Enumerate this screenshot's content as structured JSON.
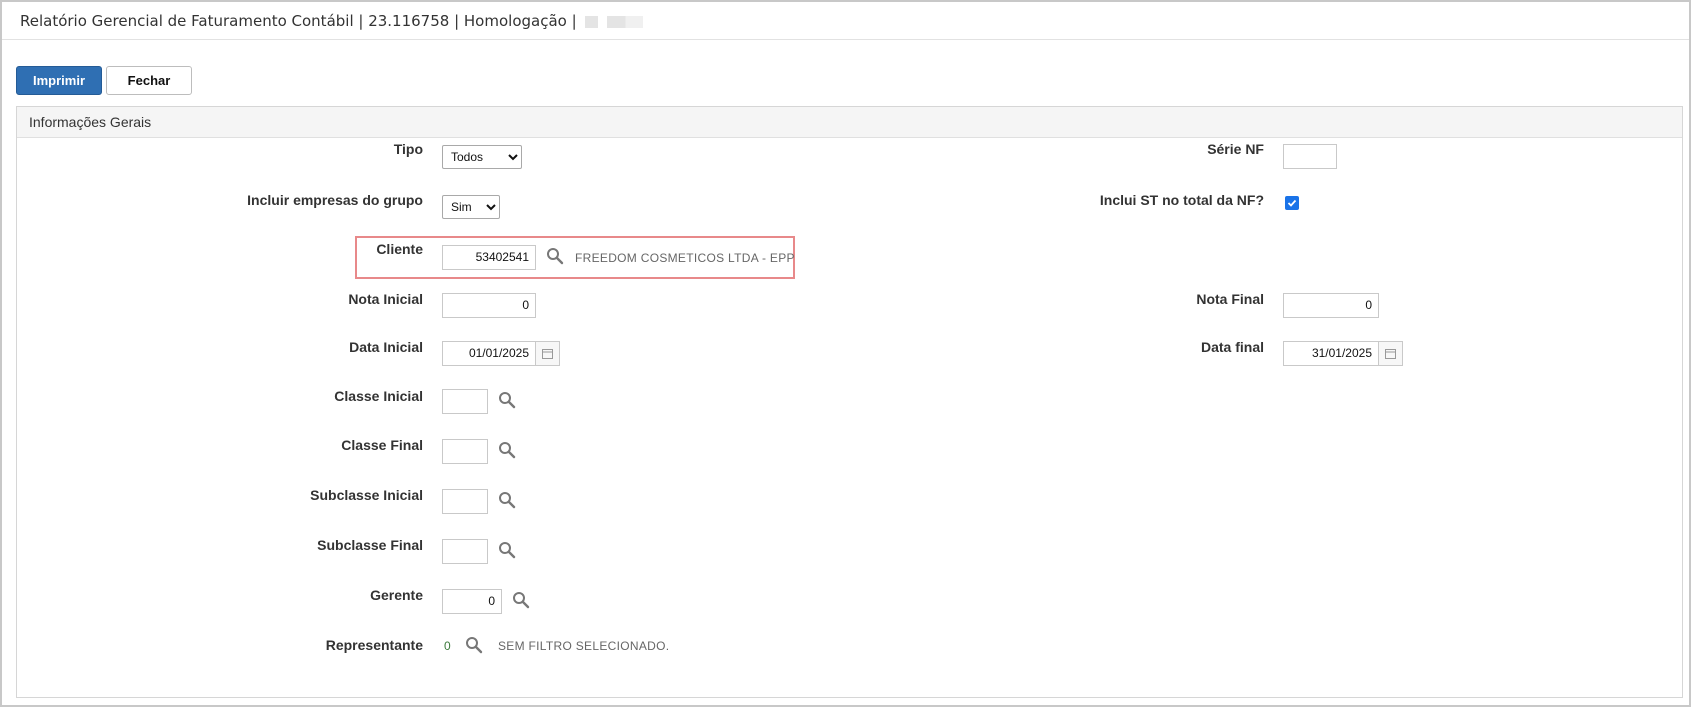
{
  "window": {
    "title": "Relatório Gerencial de Faturamento Contábil | 23.116758 | Homologação |"
  },
  "toolbar": {
    "print_label": "Imprimir",
    "close_label": "Fechar"
  },
  "panel": {
    "title": "Informações Gerais"
  },
  "form": {
    "tipo": {
      "label": "Tipo",
      "value": "Todos",
      "options": [
        "Todos"
      ]
    },
    "incluir_empresas": {
      "label": "Incluir empresas do grupo",
      "value": "Sim",
      "options": [
        "Sim"
      ]
    },
    "cliente": {
      "label": "Cliente",
      "value": "53402541",
      "description": "FREEDOM COSMETICOS LTDA - EPP"
    },
    "nota_inicial": {
      "label": "Nota Inicial",
      "value": "0"
    },
    "data_inicial": {
      "label": "Data Inicial",
      "value": "01/01/2025"
    },
    "classe_inicial": {
      "label": "Classe Inicial",
      "value": ""
    },
    "classe_final": {
      "label": "Classe Final",
      "value": ""
    },
    "subclasse_inicial": {
      "label": "Subclasse Inicial",
      "value": ""
    },
    "subclasse_final": {
      "label": "Subclasse Final",
      "value": ""
    },
    "gerente": {
      "label": "Gerente",
      "value": "0"
    },
    "representante": {
      "label": "Representante",
      "value": "0",
      "description": "SEM FILTRO SELECIONADO."
    },
    "serie_nf": {
      "label": "Série NF",
      "value": ""
    },
    "inclui_st": {
      "label": "Inclui ST no total da NF?",
      "checked": true
    },
    "nota_final": {
      "label": "Nota Final",
      "value": "0"
    },
    "data_final": {
      "label": "Data final",
      "value": "31/01/2025"
    }
  },
  "colors": {
    "primary": "#2f6fb3",
    "highlight": "#e8898a",
    "checkbox": "#1a73e8"
  }
}
